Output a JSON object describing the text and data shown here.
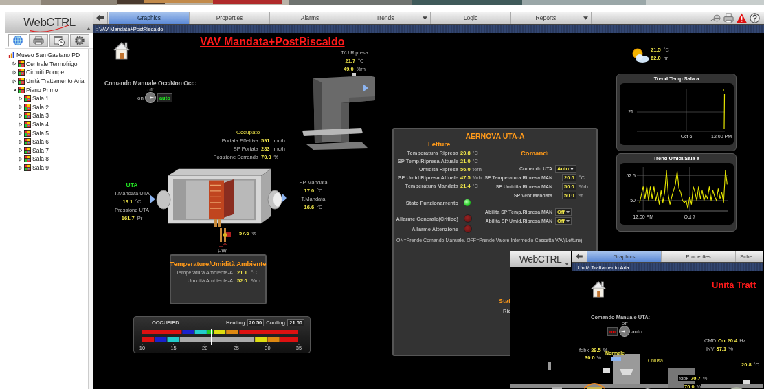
{
  "nav": {
    "logo": "WebCTRL",
    "tree": [
      {
        "label": "Museo San Gaetano PD",
        "kind": "site",
        "children": [
          {
            "label": "Centrale Termofrigo",
            "kind": "area",
            "expanded": false
          },
          {
            "label": "Circuiti Pompe",
            "kind": "area",
            "expanded": false
          },
          {
            "label": "Unità Trattamento Aria",
            "kind": "area",
            "expanded": false
          },
          {
            "label": "Piano Primo",
            "kind": "area",
            "expanded": true,
            "children": [
              {
                "label": "Sala 1",
                "kind": "area",
                "expanded": false
              },
              {
                "label": "Sala 2",
                "kind": "area",
                "expanded": false
              },
              {
                "label": "Sala 3",
                "kind": "area",
                "expanded": false
              },
              {
                "label": "Sala 4",
                "kind": "area",
                "expanded": false
              },
              {
                "label": "Sala 5",
                "kind": "area",
                "expanded": false
              },
              {
                "label": "Sala 6",
                "kind": "area",
                "expanded": false
              },
              {
                "label": "Sala 7",
                "kind": "area",
                "expanded": false
              },
              {
                "label": "Sala 8",
                "kind": "area",
                "expanded": false
              },
              {
                "label": "Sala 9",
                "kind": "area",
                "expanded": false
              }
            ]
          }
        ]
      }
    ]
  },
  "tabs": [
    {
      "label": "Graphics",
      "selected": true,
      "dropdown": false
    },
    {
      "label": "Properties",
      "selected": false,
      "dropdown": false
    },
    {
      "label": "Alarms",
      "selected": false,
      "dropdown": false
    },
    {
      "label": "Trends",
      "selected": false,
      "dropdown": true
    },
    {
      "label": "Logic",
      "selected": false,
      "dropdown": false
    },
    {
      "label": "Reports",
      "selected": false,
      "dropdown": true
    }
  ],
  "breadcrumb": ": VAV Mandata+PostRiscaldo",
  "page_title": "VAV Mandata+PostRiscaldo",
  "return_air": {
    "label": "T/U.Ripresa",
    "readings": [
      {
        "value": "21.7",
        "unit": "°C"
      },
      {
        "value": "49.0",
        "unit": "%rh"
      }
    ]
  },
  "outdoor": {
    "readings": [
      {
        "value": "21.5",
        "unit": "°C"
      },
      {
        "value": "62.0",
        "unit": "hr"
      }
    ]
  },
  "manual_switch": {
    "label": "Comando Manuale Occ/Non Occ:",
    "options": [
      {
        "label": "off",
        "kind": "off",
        "selected": false
      },
      {
        "label": "on",
        "kind": "on",
        "selected": false
      },
      {
        "label": "auto",
        "kind": "auto",
        "selected": true
      }
    ]
  },
  "vav": {
    "status": "Occupato",
    "rows": [
      {
        "label": "Portata Effettiva",
        "value": "591",
        "unit": "mc/h"
      },
      {
        "label": "SP Portata",
        "value": "283",
        "unit": "mc/h"
      },
      {
        "label": "Posizione Serranda",
        "value": "70.0",
        "unit": "%"
      }
    ]
  },
  "uta": {
    "link": "UTA",
    "rows": [
      {
        "label": "T.Mandata UTA",
        "value": "13.1",
        "unit": "°C"
      },
      {
        "label": "Pressione UTA",
        "value": "161.7",
        "unit": "Pr"
      }
    ]
  },
  "supply": {
    "rows": [
      {
        "label": "SP Mandata",
        "value": "17.0",
        "unit": "°C"
      },
      {
        "label": "T.Mandata",
        "value": "16.6",
        "unit": "°C"
      }
    ]
  },
  "valve": {
    "value": "57.6",
    "unit": "%",
    "label": "HW"
  },
  "ambient": {
    "title": "Temperature/Umidità Ambiente",
    "rows": [
      {
        "label": "Temperatura Ambiente-A",
        "value": "21.1",
        "unit": "°C"
      },
      {
        "label": "Umidità Ambiente-A",
        "value": "52.0",
        "unit": "%rh"
      }
    ]
  },
  "setpoint_bar": {
    "mode": "OCCUPIED",
    "heating_label": "Heating",
    "heating": "20.50",
    "cooling_label": "Cooling",
    "cooling": "21.50",
    "scale": [
      "10",
      "15",
      "20",
      "25",
      "30",
      "35"
    ],
    "level": 0.44
  },
  "aernova": {
    "title": "AERNOVA UTA-A",
    "readings_title": "Letture",
    "readings": [
      {
        "label": "Temperatura Ripresa",
        "value": "20.8",
        "unit": "°C"
      },
      {
        "label": "SP Temp.Ripresa Attuale",
        "value": "21.0",
        "unit": "°C"
      },
      {
        "label": "Umidita Ripresa",
        "value": "56.0",
        "unit": "%rh"
      },
      {
        "label": "SP Umid.Ripresa Attuale",
        "value": "47.5",
        "unit": "%rh"
      },
      {
        "label": "Temperatura Mandata",
        "value": "21.4",
        "unit": "°C"
      }
    ],
    "status": {
      "label": "Stato Funzionamento",
      "on": true
    },
    "alarms": [
      {
        "label": "Allarme Generale(Critico)",
        "on": false
      },
      {
        "label": "Allarme Attenzione",
        "on": false
      }
    ],
    "commands_title": "Comandi",
    "commands": [
      {
        "kind": "select",
        "label": "Comando UTA",
        "value": "Auto"
      },
      {
        "kind": "input",
        "label": "SP Temperatura Ripresa MAN",
        "value": "20.5",
        "unit": "°C"
      },
      {
        "kind": "input",
        "label": "SP Umidita Ripresa MAN",
        "value": "50.0",
        "unit": "%rh"
      },
      {
        "kind": "input",
        "label": "SP Vent.Mandata",
        "value": "50.0",
        "unit": "%"
      }
    ],
    "enables": [
      {
        "kind": "select",
        "label": "Abilita SP Temp.Ripresa MAN",
        "value": "Off"
      },
      {
        "kind": "select",
        "label": "Abilita SP Umid.Ripresa MAN",
        "value": "Off"
      }
    ],
    "note": "ON=Prende Comando Manuale. OFF=Prende Valore Intermedio Cassetta VAV(Letture)",
    "status_heading": "Stat",
    "status_row": "Ric"
  },
  "trend_temp": {
    "title": "Trend Temp.Sala a",
    "ytick": "21",
    "xticks": [
      "Oct 6",
      "12:00 PM"
    ]
  },
  "trend_humidity": {
    "title": "Trend Umidi.Sala a",
    "chart_data": {
      "type": "line",
      "categories": [
        null,
        null,
        "12:00 PM",
        null,
        null,
        null,
        null,
        null,
        null,
        null,
        null,
        null,
        null,
        null,
        null,
        null,
        null,
        null,
        null,
        null,
        null,
        null,
        null,
        null,
        null,
        null,
        null,
        null,
        "Oct 7",
        null,
        null,
        null,
        null,
        null,
        null,
        null,
        null,
        null,
        null,
        null,
        null,
        null,
        null,
        null,
        null,
        null,
        null,
        null,
        null,
        null
      ],
      "series": [
        {
          "color": "#e6e600",
          "values": [
            49.8,
            50.6,
            51.4,
            50.2,
            51.4,
            50.0,
            51.4,
            50.2,
            51.4,
            50.0,
            50.8,
            49.6,
            51.0,
            49.8,
            50.8,
            53.0,
            50.6,
            49.6,
            50.4,
            51.0,
            51.6,
            52.9,
            51.2,
            50.8,
            50.0,
            49.8,
            50.0,
            49.2,
            50.4,
            49.6,
            51.4,
            50.8,
            50.0,
            51.4,
            50.2,
            51.0,
            50.0,
            50.6,
            50.2,
            51.4,
            50.0,
            51.0,
            50.4,
            50.0,
            51.2,
            50.2,
            50.8,
            49.8,
            53.0,
            51.6
          ]
        }
      ],
      "ylim": [
        49.1,
        53.2
      ],
      "yticks": [
        50,
        52.5
      ]
    }
  },
  "second_window": {
    "logo": "WebCTRL",
    "tabs": [
      {
        "label": "Graphics",
        "selected": true
      },
      {
        "label": "Properties",
        "selected": false
      },
      {
        "label": "Sche",
        "selected": false
      }
    ],
    "breadcrumb": ": Unità Trattamento Aria",
    "page_title": "Unità Tratt",
    "manual_switch": {
      "label": "Comando Manuale UTA:",
      "options": [
        {
          "label": "off",
          "kind": "off",
          "selected": false
        },
        {
          "label": "on",
          "kind": "on",
          "selected": true
        },
        {
          "label": "auto",
          "kind": "auto",
          "selected": false
        }
      ]
    },
    "fan_cmd": {
      "label": "CMD",
      "state": "On",
      "value": "20.4",
      "unit": "Hz"
    },
    "inverter": {
      "label": "INV",
      "value": "37.1",
      "unit": "%"
    },
    "damper_a": {
      "label": "fdbk",
      "value": "29.5",
      "unit": "%",
      "setpoint": "30.0",
      "setpoint_unit": "%"
    },
    "filter_status": "Normale",
    "damper_state": "Chiusa",
    "temp": {
      "value": "20.8",
      "unit": "°C"
    },
    "damper_b": {
      "label": "fdbk",
      "value": "70.7",
      "unit": "%",
      "setpoint": "70.0",
      "setpoint_unit": "%"
    }
  }
}
